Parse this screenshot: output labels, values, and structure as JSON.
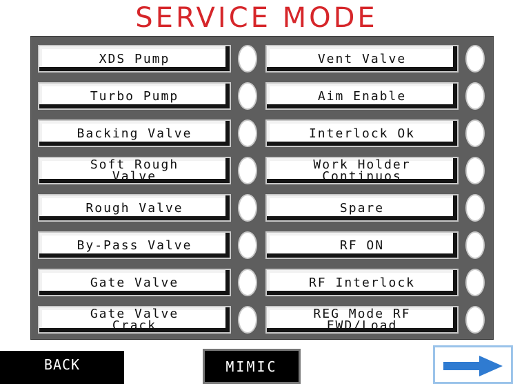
{
  "title": "SERVICE MODE",
  "buttons_left": [
    {
      "label": "XDS Pump"
    },
    {
      "label": "Turbo Pump"
    },
    {
      "label": "Backing Valve"
    },
    {
      "label": "Soft Rough\nValve"
    },
    {
      "label": "Rough Valve"
    },
    {
      "label": "By-Pass Valve"
    },
    {
      "label": "Gate Valve"
    },
    {
      "label": "Gate Valve\nCrack"
    }
  ],
  "buttons_right": [
    {
      "label": "Vent Valve"
    },
    {
      "label": "Aim Enable"
    },
    {
      "label": "Interlock Ok"
    },
    {
      "label": "Work Holder\nContinuos"
    },
    {
      "label": "Spare"
    },
    {
      "label": "RF ON"
    },
    {
      "label": "RF Interlock"
    },
    {
      "label": "REG Mode RF\nFWD/Load"
    }
  ],
  "nav": {
    "back_label": "BACK",
    "mimic_label": "MIMIC",
    "next_icon": "right-arrow-icon"
  },
  "colors": {
    "title": "#d6262a",
    "panel": "#5e5e5e",
    "next_border": "#9ac3ea",
    "arrow": "#2f7bd1"
  }
}
